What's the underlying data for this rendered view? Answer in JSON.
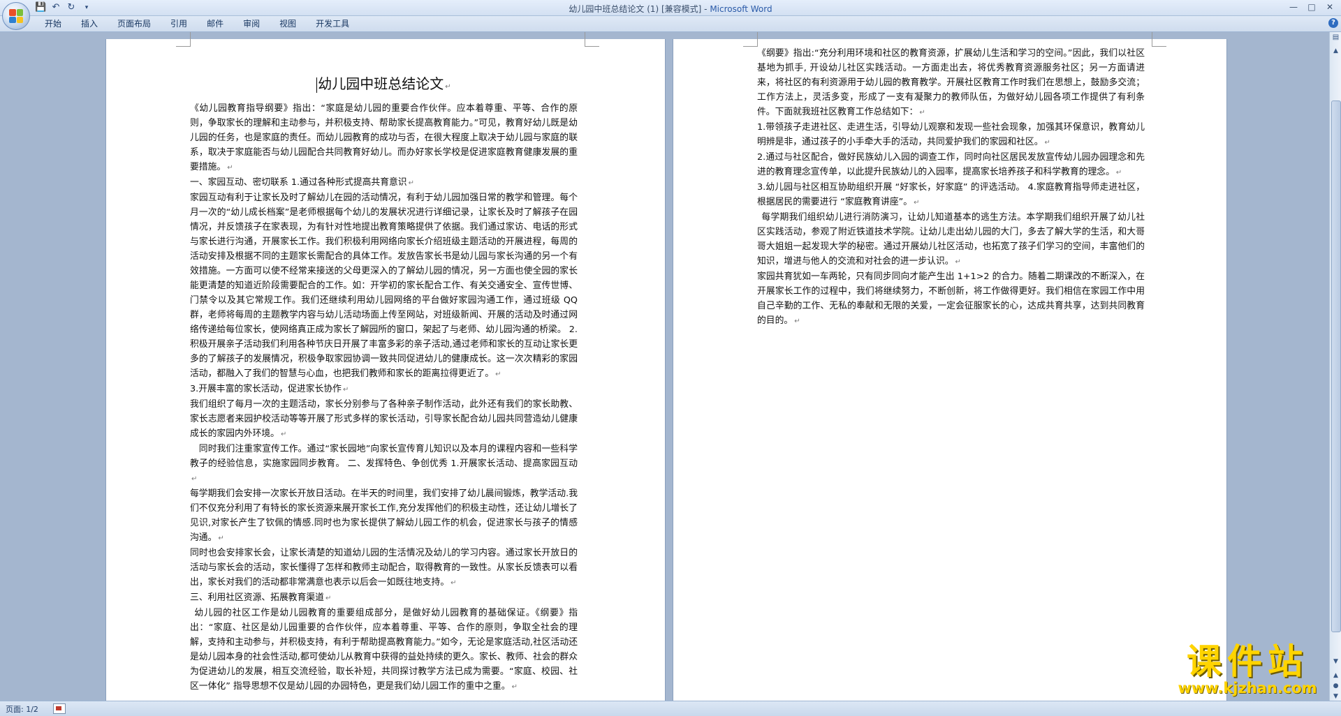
{
  "window": {
    "doc_title": "幼儿园中班总结论文 (1) [兼容模式] - ",
    "app_name": "Microsoft Word"
  },
  "ribbon": {
    "tabs": [
      "开始",
      "插入",
      "页面布局",
      "引用",
      "邮件",
      "审阅",
      "视图",
      "开发工具"
    ]
  },
  "document": {
    "title": "幼儿园中班总结论文",
    "page1": [
      "《幼儿园教育指导纲要》指出：“家庭是幼儿园的重要合作伙伴。应本着尊重、平等、合作的原则，争取家长的理解和主动参与，并积极支持、帮助家长提高教育能力。”可见，教育好幼儿既是幼儿园的任务，也是家庭的责任。而幼儿园教育的成功与否，在很大程度上取决于幼儿园与家庭的联系，取决于家庭能否与幼儿园配合共同教育好幼儿。而办好家长学校是促进家庭教育健康发展的重要措施。",
      "一、家园互动、密切联系 1.通过各种形式提高共育意识",
      "家园互动有利于让家长及时了解幼儿在园的活动情况，有利于幼儿园加强日常的教学和管理。每个月一次的“幼儿成长档案”是老师根据每个幼儿的发展状况进行详细记录，让家长及时了解孩子在园情况，并反馈孩子在家表现，为有针对性地提出教育策略提供了依据。我们通过家访、电话的形式与家长进行沟通，开展家长工作。我们积极利用网络向家长介绍班级主题活动的开展进程，每周的活动安排及根据不同的主题家长需配合的具体工作。发放告家长书是幼儿园与家长沟通的另一个有效措施。一方面可以使不经常来接送的父母更深入的了解幼儿园的情况，另一方面也使全园的家长能更清楚的知道近阶段需要配合的工作。如：开学初的家长配合工作、有关交通安全、宣传世博、门禁令以及其它常规工作。我们还继续利用幼儿园网络的平台做好家园沟通工作，通过班级 QQ 群，老师将每周的主题教学内容与幼儿活动场面上传至网站，对班级新闻、开展的活动及时通过网络传递给每位家长，使网络真正成为家长了解园所的窗口，架起了与老师、幼儿园沟通的桥梁。 2.积极开展亲子活动我们利用各种节庆日开展了丰富多彩的亲子活动,通过老师和家长的互动让家长更多的了解孩子的发展情况，积极争取家园协调一致共同促进幼儿的健康成长。这一次次精彩的家园活动，都融入了我们的智慧与心血，也把我们教师和家长的距离拉得更近了。",
      "3.开展丰富的家长活动，促进家长协作",
      "我们组织了每月一次的主题活动，家长分别参与了各种亲子制作活动，此外还有我们的家长助教、家长志愿者来园护校活动等等开展了形式多样的家长活动，引导家长配合幼儿园共同营造幼儿健康成长的家园内外环境。",
      "同时我们注重家宣传工作。通过“家长园地”向家长宣传育儿知识以及本月的课程内容和一些科学教子的经验信息，实施家园同步教育。 二、发挥特色、争创优秀 1.开展家长活动、提高家园互动",
      "每学期我们会安排一次家长开放日活动。在半天的时间里，我们安排了幼儿晨间锻炼，教学活动.我们不仅充分利用了有特长的家长资源来展开家长工作,充分发挥他们的积极主动性，还让幼儿增长了见识,对家长产生了钦佩的情感.同时也为家长提供了解幼儿园工作的机会，促进家长与孩子的情感沟通。",
      "同时也会安排家长会，让家长清楚的知道幼儿园的生活情况及幼儿的学习内容。通过家长开放日的活动与家长会的活动，家长懂得了怎样和教师主动配合，取得教育的一致性。从家长反馈表可以看出，家长对我们的活动都非常满意也表示以后会一如既往地支持。",
      "三、利用社区资源、拓展教育渠道",
      "幼儿园的社区工作是幼儿园教育的重要组成部分，是做好幼儿园教育的基础保证。《纲要》指出：“家庭、社区是幼儿园重要的合作伙伴，应本着尊重、平等、合作的原则，争取全社会的理解，支持和主动参与，并积极支持，有利于帮助提高教育能力。”如今，无论是家庭活动,社区活动还是幼儿园本身的社会性活动,都可使幼儿从教育中获得的益处持续的更久。家长、教师、社会的群众为促进幼儿的发展，相互交流经验，取长补短，共同探讨教学方法已成为需要。“家庭、校园、社区一体化” 指导思想不仅是幼儿园的办园特色，更是我们幼儿园工作的重中之重。"
    ],
    "page2": [
      "《纲要》指出:“充分利用环境和社区的教育资源，扩展幼儿生活和学习的空间。”因此，我们以社区基地为抓手, 开设幼儿社区实践活动。一方面走出去，将优秀教育资源服务社区；另一方面请进来，将社区的有利资源用于幼儿园的教育教学。开展社区教育工作时我们在思想上，鼓励多交流；工作方法上，灵活多变，形成了一支有凝聚力的教师队伍，为做好幼儿园各项工作提供了有利条件。下面就我班社区教育工作总结如下：",
      "1.带领孩子走进社区、走进生活，引导幼儿观察和发现一些社会现象，加强其环保意识，教育幼儿明辨是非，通过孩子的小手牵大手的活动，共同爱护我们的家园和社区。",
      "2.通过与社区配合，做好民族幼儿入园的调查工作，同时向社区居民发放宣传幼儿园办园理念和先进的教育理念宣传单，以此提升民族幼儿的入园率，提高家长培养孩子和科学教育的理念。",
      "3.幼儿园与社区相互协助组织开展 “好家长，好家庭” 的评选活动。 4.家庭教育指导师走进社区，根据居民的需要进行 “家庭教育讲座”。",
      "每学期我们组织幼儿进行消防演习，让幼儿知道基本的逃生方法。本学期我们组织开展了幼儿社区实践活动，参观了附近铁道技术学院。让幼儿走出幼儿园的大门，多去了解大学的生活，和大哥哥大姐姐一起发现大学的秘密。通过开展幼儿社区活动，也拓宽了孩子们学习的空间，丰富他们的知识，增进与他人的交流和对社会的进一步认识。",
      "家园共育犹如一车两轮，只有同步同向才能产生出 1+1>2 的合力。随着二期课改的不断深入，在开展家长工作的过程中，我们将继续努力，不断创新，将工作做得更好。我们相信在家园工作中用自己辛勤的工作、无私的奉献和无限的关爱，一定会征服家长的心，达成共育共享，达到共同教育的目的。"
    ]
  },
  "statusbar": {
    "page_info": "页面: 1/2"
  },
  "watermark": {
    "title": "课件站",
    "url": "www.kjzhan.com"
  },
  "colors": {
    "accent": "#2a5aa8",
    "watermark": "#ffd400",
    "workspace": "#a4b6cf"
  },
  "icons": [
    "office-button-icon",
    "save-icon",
    "undo-icon",
    "redo-icon",
    "customize-qat-icon",
    "minimize-icon",
    "maximize-icon",
    "close-icon",
    "help-icon"
  ]
}
